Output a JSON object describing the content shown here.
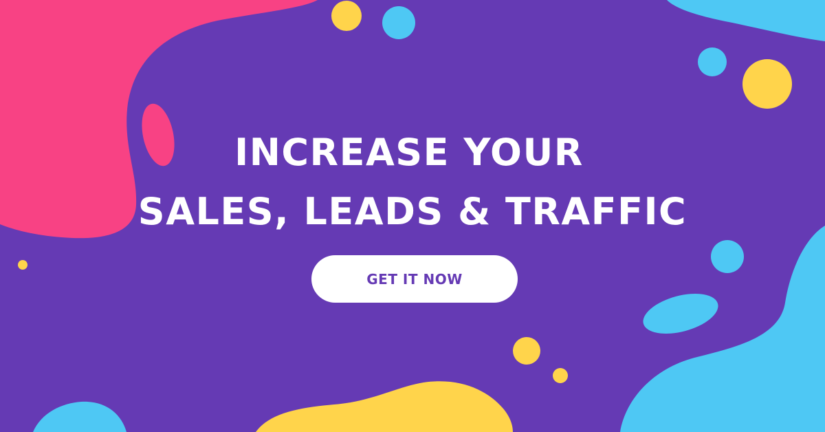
{
  "headline": {
    "line1": "INCREASE YOUR",
    "line2": "SALES, LEADS & TRAFFIC"
  },
  "cta": {
    "label": "GET IT NOW"
  },
  "colors": {
    "background": "#653ab4",
    "pink": "#f84284",
    "yellow": "#ffd44b",
    "cyan": "#4ec8f4",
    "text": "#ffffff",
    "button_text": "#653ab4"
  }
}
